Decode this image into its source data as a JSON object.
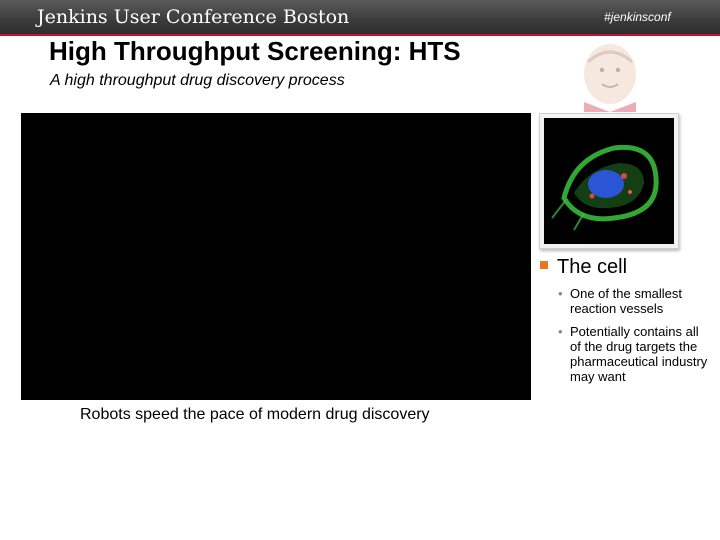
{
  "header": {
    "conference": "Jenkins User Conference Boston",
    "hashtag": "#jenkinsconf"
  },
  "slide": {
    "title": "High Throughput Screening: HTS",
    "subtitle": "A high throughput drug discovery process",
    "video_caption": "Robots speed the pace of modern drug discovery"
  },
  "bullets": {
    "main": "The cell",
    "subs": [
      "One of the smallest reaction vessels",
      "Potentially contains all of the drug targets the pharmaceutical industry may want"
    ]
  },
  "colors": {
    "header_bg": "#3b3b3b",
    "accent_red": "#c8102e",
    "bullet_orange": "#e87722"
  }
}
